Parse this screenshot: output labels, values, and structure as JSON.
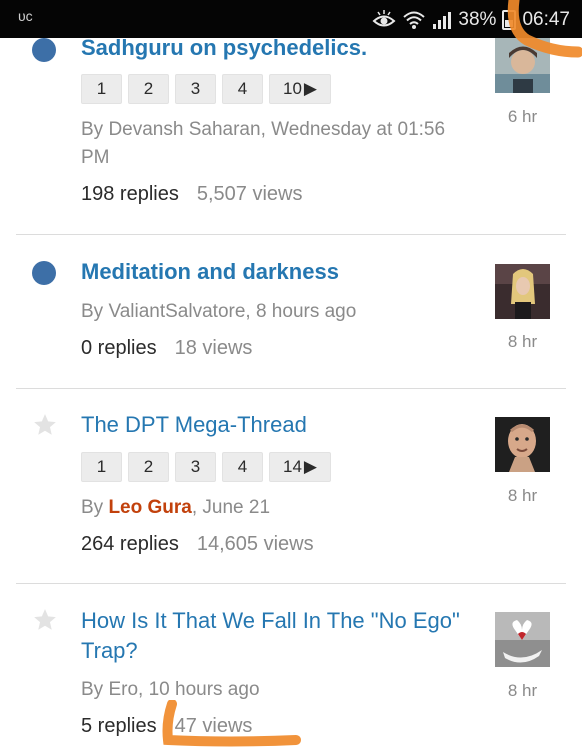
{
  "status_bar": {
    "left_text": "ᴜᴄ",
    "battery": "38%",
    "time": "06:47",
    "icons": [
      "eye-comfort-icon",
      "wifi-icon",
      "signal-icon",
      "battery-icon"
    ]
  },
  "colors": {
    "link": "#2577b1",
    "unread_dot": "#3d6fa7",
    "staff_name": "#c2410c",
    "annotation": "#f08a2a"
  },
  "threads": [
    {
      "title": "Sadhguru on psychedelics.",
      "unread": true,
      "pages": [
        "1",
        "2",
        "3",
        "4",
        "10"
      ],
      "meta_prefix": "By ",
      "author": "Devansh Saharan",
      "date": ", Wednesday at 01:56 PM",
      "replies": "198 replies",
      "views": "5,507 views",
      "last_post": "6 hr"
    },
    {
      "title": "Meditation and darkness",
      "unread": true,
      "meta_prefix": "By ",
      "author": "ValiantSalvatore",
      "date": ", 8 hours ago",
      "replies": "0 replies",
      "views": "18 views",
      "last_post": "8 hr"
    },
    {
      "title": "The DPT Mega-Thread",
      "unread": false,
      "pages": [
        "1",
        "2",
        "3",
        "4",
        "14"
      ],
      "meta_prefix": "By ",
      "author": "Leo Gura",
      "date": ", June 21",
      "replies": "264 replies",
      "views": "14,605 views",
      "last_post": "8 hr"
    },
    {
      "title": "How Is It That We Fall In The \"No Ego\" Trap?",
      "unread": false,
      "meta_prefix": "By ",
      "author": "Ero",
      "date": ", 10 hours ago",
      "replies": "5 replies",
      "views": "47 views",
      "last_post": "8 hr"
    }
  ]
}
